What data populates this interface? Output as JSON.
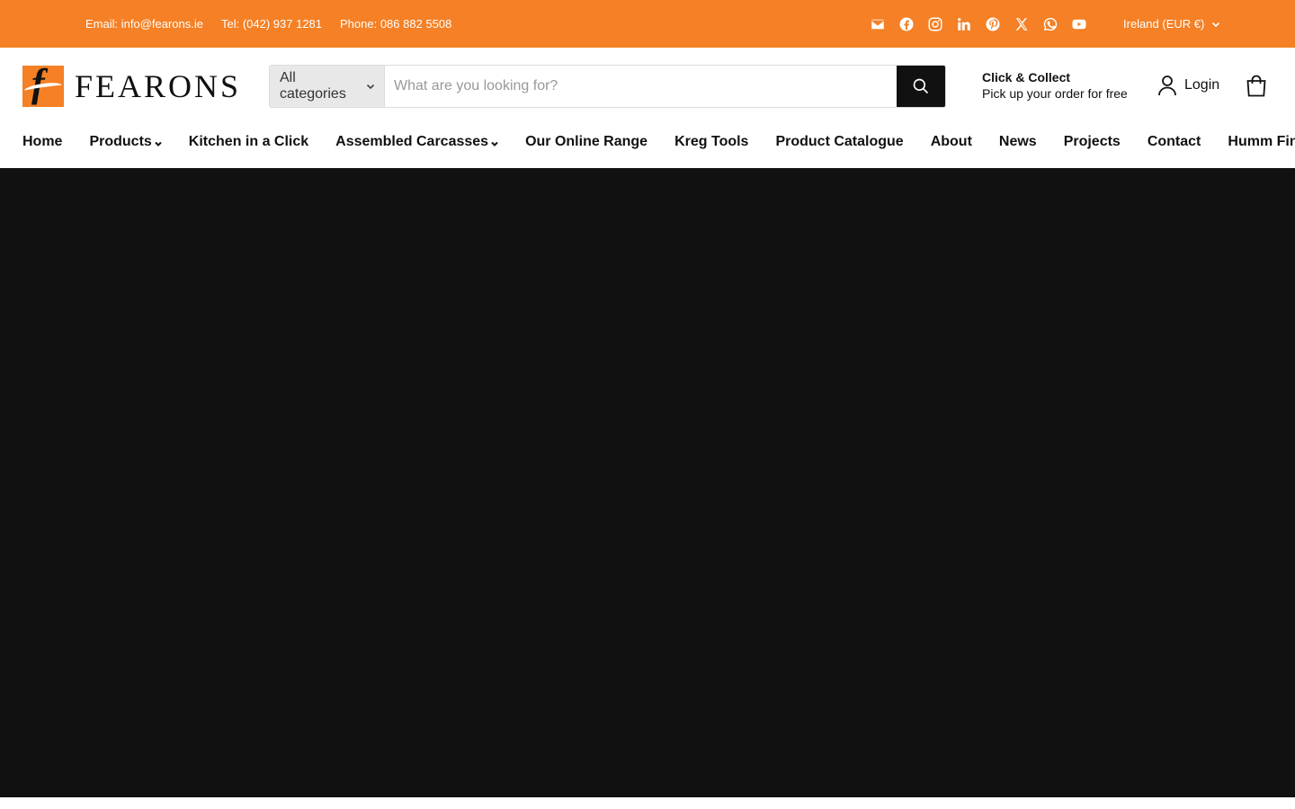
{
  "colors": {
    "brand": "#f58025",
    "hero": "#111111"
  },
  "topbar": {
    "email": "Email: info@fearons.ie",
    "tel": "Tel: (042) 937 1281",
    "phone": "Phone: 086 882 5508",
    "socials": [
      "email-icon",
      "facebook-icon",
      "instagram-icon",
      "linkedin-icon",
      "pinterest-icon",
      "x-icon",
      "whatsapp-icon",
      "youtube-icon"
    ],
    "region": "Ireland (EUR €)"
  },
  "header": {
    "logo_text": "FEARONS",
    "search": {
      "category": "All categories",
      "placeholder": "What are you looking for?"
    },
    "click_collect": {
      "title": "Click & Collect",
      "subtitle": "Pick up your order for free"
    },
    "login_label": "Login"
  },
  "nav": {
    "items": [
      {
        "label": "Home"
      },
      {
        "label": "Products"
      },
      {
        "label": "Kitchen in a Click"
      },
      {
        "label": "Assembled Carcasses"
      },
      {
        "label": "Our Online Range"
      },
      {
        "label": "Kreg Tools"
      },
      {
        "label": "Product Catalogue"
      },
      {
        "label": "About"
      },
      {
        "label": "News"
      },
      {
        "label": "Projects"
      },
      {
        "label": "Contact"
      },
      {
        "label": "Humm Finance"
      }
    ]
  }
}
